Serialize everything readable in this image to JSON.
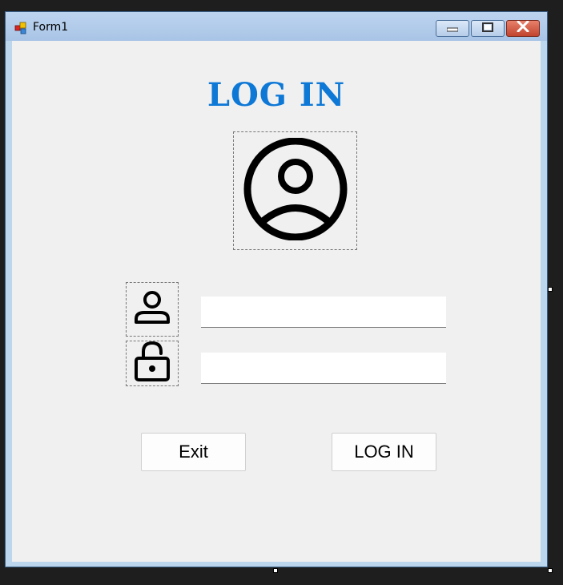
{
  "window": {
    "title": "Form1",
    "app_icon": "winforms-app-icon",
    "controls": {
      "minimize_icon": "minimize-icon",
      "maximize_icon": "maximize-icon",
      "close_icon": "close-icon"
    }
  },
  "form": {
    "heading": "LOG IN",
    "heading_color": "#0e78d6",
    "avatar_icon": "user-circle-icon",
    "username": {
      "icon": "user-icon",
      "value": "",
      "placeholder": ""
    },
    "password": {
      "icon": "lock-icon",
      "value": "",
      "placeholder": ""
    },
    "buttons": {
      "exit_label": "Exit",
      "login_label": "LOG IN"
    }
  }
}
